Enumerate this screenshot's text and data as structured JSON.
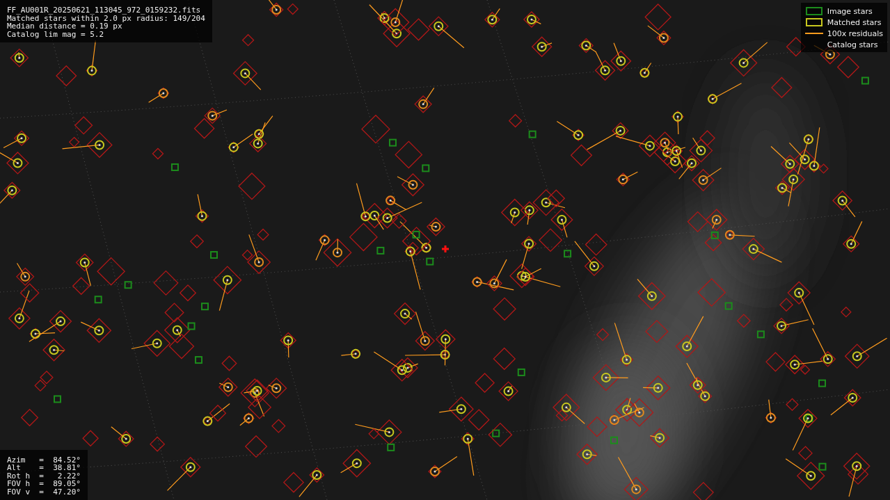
{
  "plot": {
    "info_lines": [
      "FF_AU001R_20250621_113045_972_0159232.fits",
      "Matched stars within 2.0 px radius: 149/204",
      "Median distance = 0.19 px",
      "Catalog lim mag = 5.2"
    ],
    "legend": [
      {
        "label": "Image stars",
        "kind": "box",
        "color": "#1c8c1c"
      },
      {
        "label": "Matched stars",
        "kind": "box",
        "color": "#c8c81e"
      },
      {
        "label": "100x residuals",
        "kind": "line",
        "color": "#ff9c1e"
      },
      {
        "label": "Catalog stars",
        "kind": "blank"
      }
    ],
    "pointing": [
      "Azim   =  84.52°",
      "Alt    =  38.81°",
      "Rot h  =   2.22°",
      "FOV h  =  89.05°",
      "FOV v  =  47.20°"
    ]
  }
}
